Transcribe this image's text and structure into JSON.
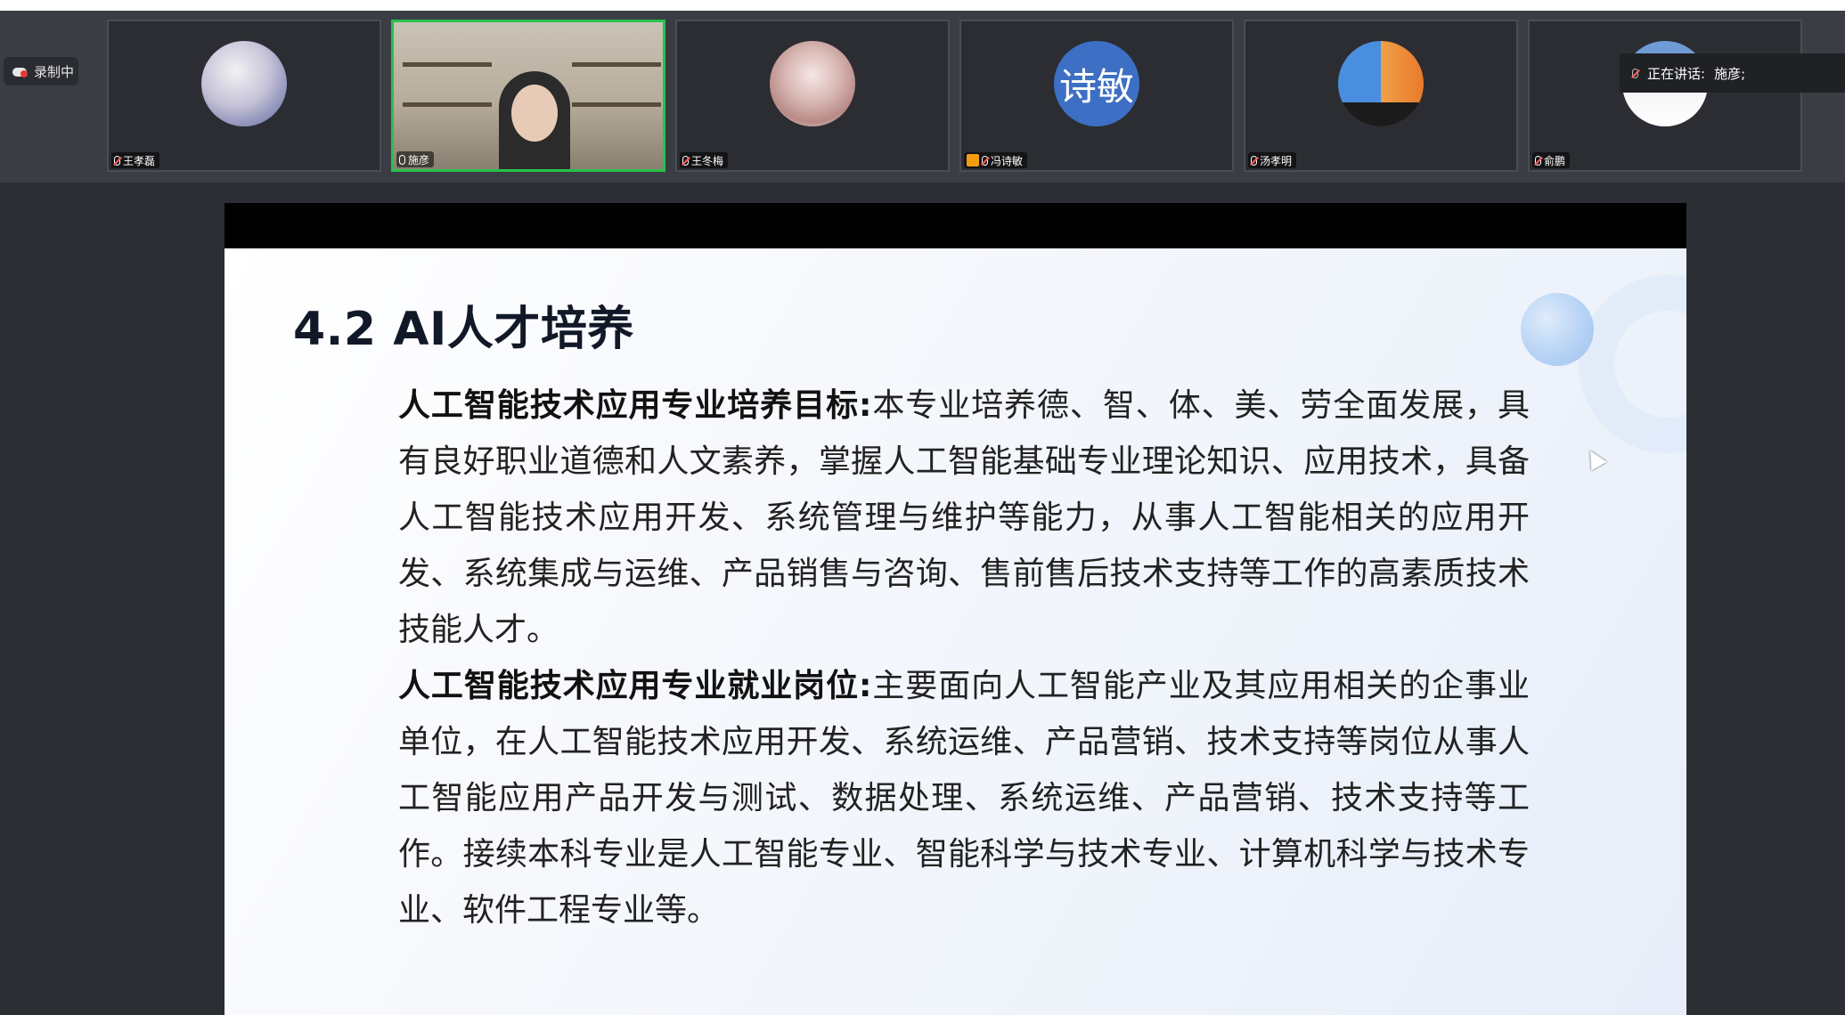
{
  "recording": {
    "label": "录制中"
  },
  "participants": [
    {
      "name": "王孝磊",
      "muted": true
    },
    {
      "name": "施彦",
      "muted": false,
      "active": true
    },
    {
      "name": "王冬梅",
      "muted": true
    },
    {
      "name": "冯诗敏",
      "muted": true,
      "avatar_text": "诗敏",
      "host": true
    },
    {
      "name": "汤孝明",
      "muted": true
    },
    {
      "name": "俞鹏",
      "muted": true
    }
  ],
  "speaking_indicator": {
    "label": "正在讲话:",
    "speaker": "施彦;"
  },
  "slide": {
    "title": "4.2 AI人才培养",
    "paragraph1_heading": "人工智能技术应用专业培养目标:",
    "paragraph1_text": "本专业培养德、智、体、美、劳全面发展，具有良好职业道德和人文素养，掌握人工智能基础专业理论知识、应用技术，具备人工智能技术应用开发、系统管理与维护等能力，从事人工智能相关的应用开发、系统集成与运维、产品销售与咨询、售前售后技术支持等工作的高素质技术技能人才。",
    "paragraph2_heading": "人工智能技术应用专业就业岗位:",
    "paragraph2_text": "主要面向人工智能产业及其应用相关的企事业单位，在人工智能技术应用开发、系统运维、产品营销、技术支持等岗位从事人工智能应用产品开发与测试、数据处理、系统运维、产品营销、技术支持等工作。接续本科专业是人工智能专业、智能科学与技术专业、计算机科学与技术专业、软件工程专业等。"
  },
  "colors": {
    "active_border": "#27c24c",
    "strip_bg": "#3a3d43",
    "slide_title": "#111827"
  }
}
